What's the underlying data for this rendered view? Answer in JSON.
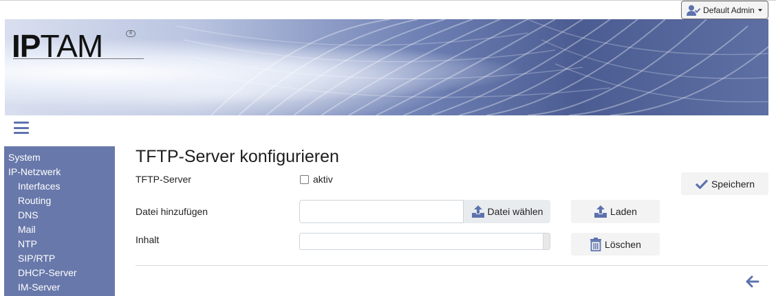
{
  "header": {
    "user_label": "Default Admin",
    "logo_bold": "IP",
    "logo_rest": "TAM"
  },
  "sidebar": {
    "items": [
      {
        "label": "System"
      },
      {
        "label": "IP-Netzwerk"
      },
      {
        "label": "Interfaces"
      },
      {
        "label": "Routing"
      },
      {
        "label": "DNS"
      },
      {
        "label": "Mail"
      },
      {
        "label": "NTP"
      },
      {
        "label": "SIP/RTP"
      },
      {
        "label": "DHCP-Server"
      },
      {
        "label": "IM-Server"
      }
    ]
  },
  "main": {
    "title": "TFTP-Server konfigurieren",
    "tftp_label": "TFTP-Server",
    "active_label": "aktiv",
    "active_checked": false,
    "save_label": "Speichern",
    "add_file_label": "Datei hinzufügen",
    "file_value": "",
    "choose_file_label": "Datei wählen",
    "load_label": "Laden",
    "content_label": "Inhalt",
    "content_selected": "",
    "delete_label": "Löschen"
  },
  "icons": {
    "user": "user-check-icon",
    "menu": "hamburger-icon",
    "save": "check-icon",
    "upload": "upload-icon",
    "delete": "trash-icon",
    "back": "arrow-left-icon"
  },
  "colors": {
    "accent": "#5d72ad",
    "sidebar_bg": "#6878aa",
    "button_bg": "#f3f3f4"
  }
}
